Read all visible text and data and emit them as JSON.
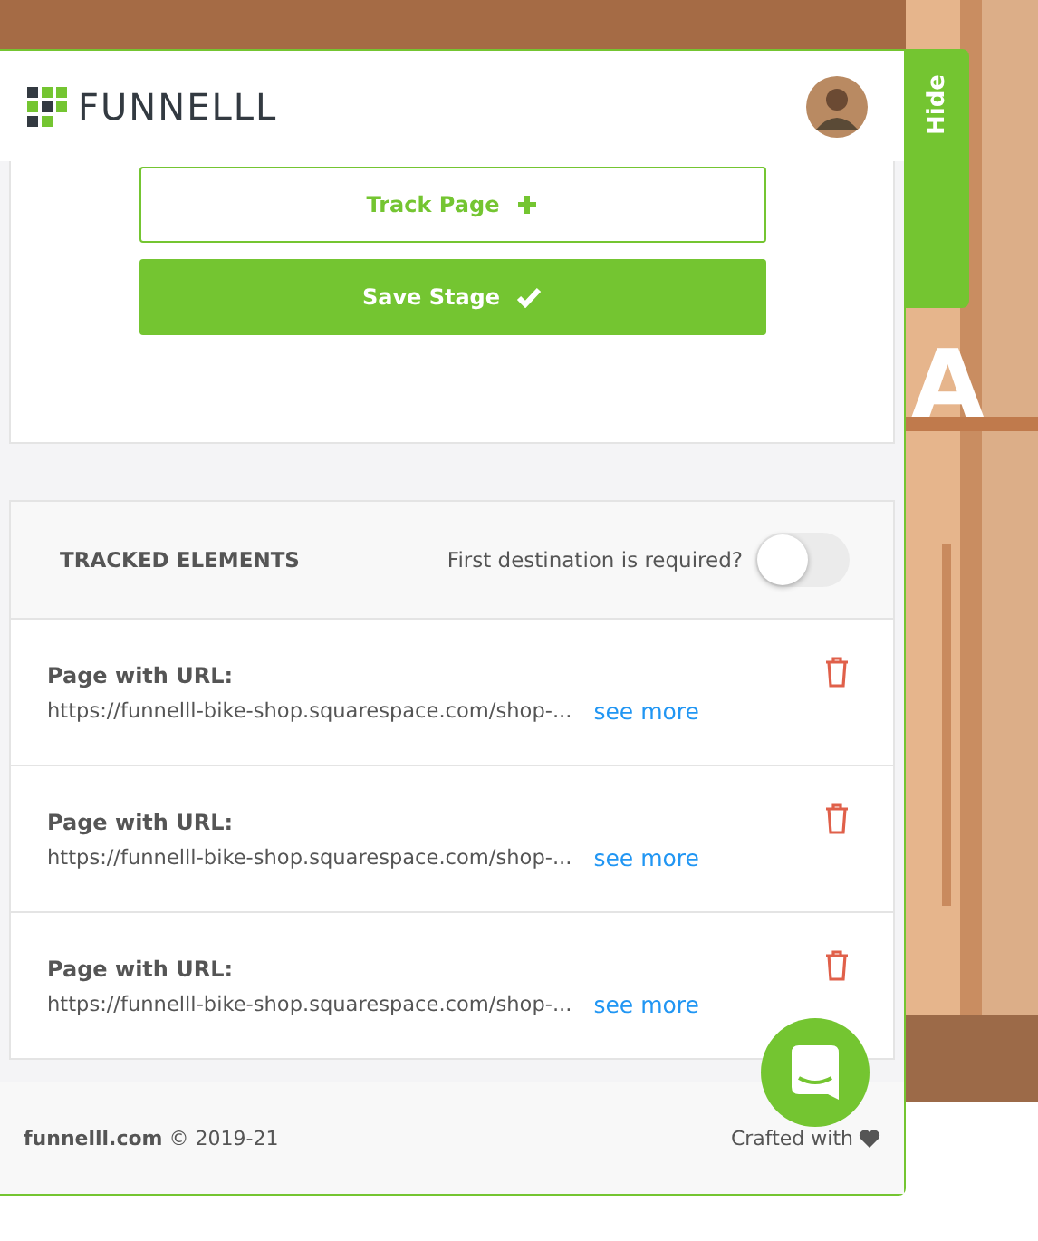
{
  "background": {
    "kind": "picture",
    "heading": "A"
  },
  "header": {
    "logo_text": "FUNNELLL",
    "hide_tab": "Hide"
  },
  "actions": [
    {
      "label": "Track Page",
      "kind": "outline"
    },
    {
      "label": "Save Stage",
      "kind": "solid"
    }
  ],
  "tracked": {
    "title": "TRACKED ELEMENTS",
    "toggle_label": "First destination is required?",
    "toggle_on": false,
    "items": [
      {
        "label": "Page with URL:",
        "url": "https://funnelll-bike-shop.squarespace.com/shop-...",
        "link": "see more"
      },
      {
        "label": "Page with URL:",
        "url": "https://funnelll-bike-shop.squarespace.com/shop-...",
        "link": "see more"
      },
      {
        "label": "Page with URL:",
        "url": "https://funnelll-bike-shop.squarespace.com/shop-...",
        "link": "see more"
      }
    ]
  },
  "footer": {
    "site": "funnelll.com",
    "copyright": "© 2019-21",
    "crafted": "Crafted with"
  }
}
